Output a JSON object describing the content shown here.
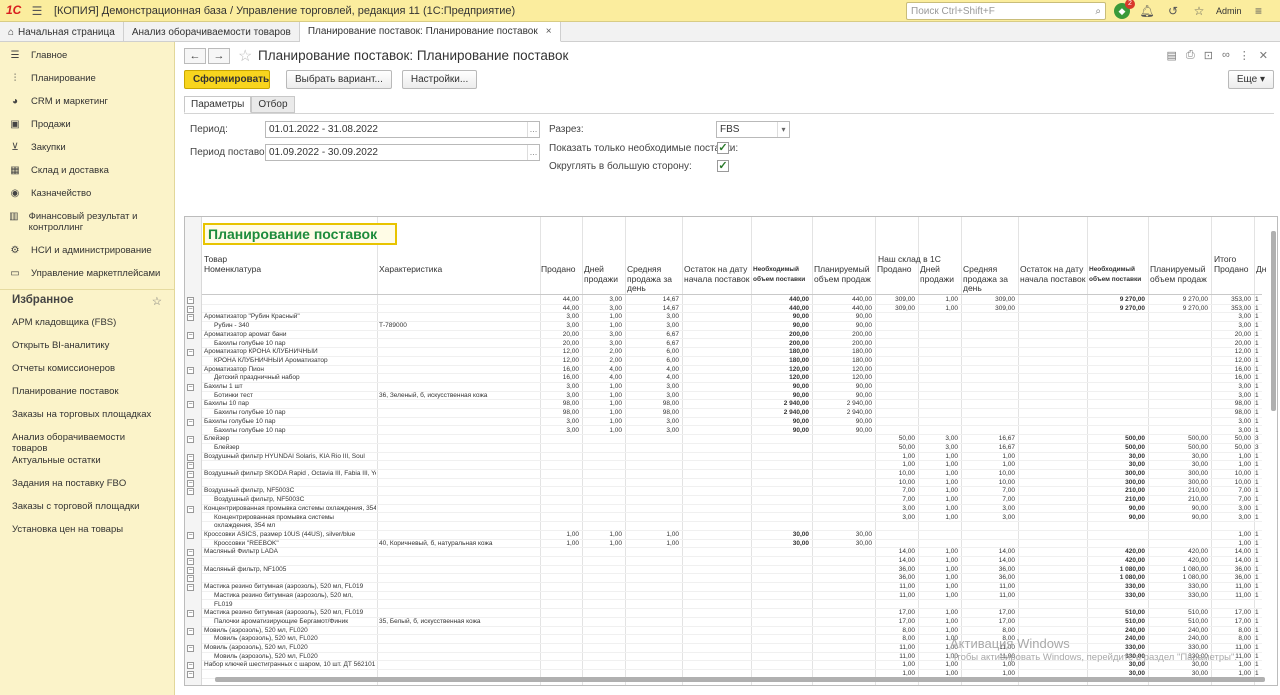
{
  "app": {
    "title": "[КОПИЯ] Демонстрационная база / Управление торговлей, редакция 11  (1С:Предприятие)",
    "search_placeholder": "Поиск Ctrl+Shift+F",
    "notification_count": "2",
    "user": "Admin"
  },
  "tabs": [
    {
      "label": "Начальная страница"
    },
    {
      "label": "Анализ оборачиваемости товаров"
    },
    {
      "label": "Планирование поставок: Планирование поставок"
    }
  ],
  "sidebar": {
    "items": [
      {
        "label": "Главное",
        "icon": "menu-icon"
      },
      {
        "label": "Планирование",
        "icon": "planning-icon"
      },
      {
        "label": "CRM и маркетинг",
        "icon": "pie-icon"
      },
      {
        "label": "Продажи",
        "icon": "bag-icon"
      },
      {
        "label": "Закупки",
        "icon": "cart-icon"
      },
      {
        "label": "Склад и доставка",
        "icon": "warehouse-icon"
      },
      {
        "label": "Казначейство",
        "icon": "money-icon"
      },
      {
        "label": "Финансовый результат и контроллинг",
        "icon": "chart-icon"
      },
      {
        "label": "НСИ и администрирование",
        "icon": "gear-icon"
      },
      {
        "label": "Управление маркетплейсами",
        "icon": "chat-icon"
      }
    ],
    "fav_title": "Избранное",
    "favorites": [
      "АРМ кладовщика (FBS)",
      "Открыть BI-аналитику",
      "Отчеты комиссионеров",
      "Планирование поставок",
      "Заказы на торговых площадках",
      "Анализ оборачиваемости товаров",
      "Актуальные остатки",
      "Задания на поставку FBO",
      "Заказы с торговой площадки",
      "Установка цен на товары"
    ]
  },
  "form": {
    "title": "Планирование поставок: Планирование поставок",
    "generate": "Сформировать",
    "choose_variant": "Выбрать вариант...",
    "settings": "Настройки...",
    "more": "Еще",
    "tab_params": "Параметры",
    "tab_filter": "Отбор",
    "period_label": "Период:",
    "period_value": "01.01.2022 - 31.08.2022",
    "delivery_label": "Период поставок:",
    "delivery_value": "01.09.2022 - 30.09.2022",
    "section_label": "Разрез:",
    "section_value": "FBS",
    "only_needed_label": "Показать только необходимые поставки:",
    "only_needed": true,
    "round_up_label": "Округлять в большую сторону:",
    "round_up": true
  },
  "report": {
    "title": "Планирование поставок",
    "group_product": "Товар",
    "col_nomenclature": "Номенклатура",
    "col_characteristic": "Характеристика",
    "group_warehouse": "Наш склад в 1С",
    "group_total": "Итого",
    "col_sold": "Продано",
    "col_days": "Дней продажи",
    "col_avg": "Средняя продажа за день",
    "col_stock": "Остаток на дату начала поставок",
    "col_need": "Необходимый объем поставки",
    "col_plan": "Планируемый объем продаж",
    "col_days2": "Дне",
    "rows": [
      [
        "",
        "",
        "44,00",
        "3,00",
        "14,67",
        "",
        "440,00",
        "440,00",
        "309,00",
        "1,00",
        "309,00",
        "",
        "9 270,00",
        "9 270,00",
        "353,00",
        "1"
      ],
      [
        "",
        "",
        "44,00",
        "3,00",
        "14,67",
        "",
        "440,00",
        "440,00",
        "309,00",
        "1,00",
        "309,00",
        "",
        "9 270,00",
        "9 270,00",
        "353,00",
        "1"
      ],
      [
        "Ароматизатор \"Рубин Красный\"",
        "",
        "3,00",
        "1,00",
        "3,00",
        "",
        "90,00",
        "90,00",
        "",
        "",
        "",
        "",
        "",
        "",
        "3,00",
        "1"
      ],
      [
        "Рубин - 340",
        "Т-789000",
        "3,00",
        "1,00",
        "3,00",
        "",
        "90,00",
        "90,00",
        "",
        "",
        "",
        "",
        "",
        "",
        "3,00",
        "1"
      ],
      [
        "Ароматизатор аромат бани",
        "",
        "20,00",
        "3,00",
        "6,67",
        "",
        "200,00",
        "200,00",
        "",
        "",
        "",
        "",
        "",
        "",
        "20,00",
        "1"
      ],
      [
        "Бахилы голубые 10 пар",
        "",
        "20,00",
        "3,00",
        "6,67",
        "",
        "200,00",
        "200,00",
        "",
        "",
        "",
        "",
        "",
        "",
        "20,00",
        "1"
      ],
      [
        "Ароматизатор КРОНА КЛУБНИЧНЫЙ",
        "",
        "12,00",
        "2,00",
        "6,00",
        "",
        "180,00",
        "180,00",
        "",
        "",
        "",
        "",
        "",
        "",
        "12,00",
        "1"
      ],
      [
        "КРОНА КЛУБНИЧНЫЙ Ароматизатор",
        "",
        "12,00",
        "2,00",
        "6,00",
        "",
        "180,00",
        "180,00",
        "",
        "",
        "",
        "",
        "",
        "",
        "12,00",
        "1"
      ],
      [
        "Ароматизатор Пион",
        "",
        "16,00",
        "4,00",
        "4,00",
        "",
        "120,00",
        "120,00",
        "",
        "",
        "",
        "",
        "",
        "",
        "16,00",
        "1"
      ],
      [
        "Детский праздничный набор",
        "",
        "16,00",
        "4,00",
        "4,00",
        "",
        "120,00",
        "120,00",
        "",
        "",
        "",
        "",
        "",
        "",
        "16,00",
        "1"
      ],
      [
        "Бахилы 1 шт",
        "",
        "3,00",
        "1,00",
        "3,00",
        "",
        "90,00",
        "90,00",
        "",
        "",
        "",
        "",
        "",
        "",
        "3,00",
        "1"
      ],
      [
        "Ботинки тест",
        "36, Зеленый, б, искусственная кожа",
        "3,00",
        "1,00",
        "3,00",
        "",
        "90,00",
        "90,00",
        "",
        "",
        "",
        "",
        "",
        "",
        "3,00",
        "1"
      ],
      [
        "Бахилы 10 пар",
        "",
        "98,00",
        "1,00",
        "98,00",
        "",
        "2 940,00",
        "2 940,00",
        "",
        "",
        "",
        "",
        "",
        "",
        "98,00",
        "1"
      ],
      [
        "Бахилы голубые 10 пар",
        "",
        "98,00",
        "1,00",
        "98,00",
        "",
        "2 940,00",
        "2 940,00",
        "",
        "",
        "",
        "",
        "",
        "",
        "98,00",
        "1"
      ],
      [
        "Бахилы голубые 10 пар",
        "",
        "3,00",
        "1,00",
        "3,00",
        "",
        "90,00",
        "90,00",
        "",
        "",
        "",
        "",
        "",
        "",
        "3,00",
        "1"
      ],
      [
        "Бахилы голубые 10 пар",
        "",
        "3,00",
        "1,00",
        "3,00",
        "",
        "90,00",
        "90,00",
        "",
        "",
        "",
        "",
        "",
        "",
        "3,00",
        "1"
      ],
      [
        "Блейзер",
        "",
        "",
        "",
        "",
        "",
        "",
        "",
        "50,00",
        "3,00",
        "16,67",
        "",
        "500,00",
        "500,00",
        "50,00",
        "3"
      ],
      [
        "Блейзер",
        "",
        "",
        "",
        "",
        "",
        "",
        "",
        "50,00",
        "3,00",
        "16,67",
        "",
        "500,00",
        "500,00",
        "50,00",
        "3"
      ],
      [
        "Воздушный фильтр HYUNDAI Solaris, KIA Rio III, Soul",
        "",
        "",
        "",
        "",
        "",
        "",
        "",
        "1,00",
        "1,00",
        "1,00",
        "",
        "30,00",
        "30,00",
        "1,00",
        "1"
      ],
      [
        "",
        "",
        "",
        "",
        "",
        "",
        "",
        "",
        "1,00",
        "1,00",
        "1,00",
        "",
        "30,00",
        "30,00",
        "1,00",
        "1"
      ],
      [
        "Воздушный фильтр SKODA Rapid , Octavia III, Fabia III, Yeti; VOLKSWAGEN Polo V",
        "",
        "",
        "",
        "",
        "",
        "",
        "",
        "10,00",
        "1,00",
        "10,00",
        "",
        "300,00",
        "300,00",
        "10,00",
        "1"
      ],
      [
        "",
        "",
        "",
        "",
        "",
        "",
        "",
        "",
        "10,00",
        "1,00",
        "10,00",
        "",
        "300,00",
        "300,00",
        "10,00",
        "1"
      ],
      [
        "Воздушный фильтр, NF5003C",
        "",
        "",
        "",
        "",
        "",
        "",
        "",
        "7,00",
        "1,00",
        "7,00",
        "",
        "210,00",
        "210,00",
        "7,00",
        "1"
      ],
      [
        "Воздушный фильтр, NF5003C",
        "",
        "",
        "",
        "",
        "",
        "",
        "",
        "7,00",
        "1,00",
        "7,00",
        "",
        "210,00",
        "210,00",
        "7,00",
        "1"
      ],
      [
        "Концентрированная промывка системы охлаждения, 354 мл",
        "",
        "",
        "",
        "",
        "",
        "",
        "",
        "3,00",
        "1,00",
        "3,00",
        "",
        "90,00",
        "90,00",
        "3,00",
        "1"
      ],
      [
        "Концентрированная промывка системы",
        "",
        "",
        "",
        "",
        "",
        "",
        "",
        "3,00",
        "1,00",
        "3,00",
        "",
        "90,00",
        "90,00",
        "3,00",
        "1"
      ],
      [
        "охлаждения, 354 мл",
        "",
        "",
        "",
        "",
        "",
        "",
        "",
        "",
        "",
        "",
        "",
        "",
        "",
        "",
        ""
      ],
      [
        "Кроссовки ASICS, размер 10US (44US), silver/blue",
        "",
        "1,00",
        "1,00",
        "1,00",
        "",
        "30,00",
        "30,00",
        "",
        "",
        "",
        "",
        "",
        "",
        "1,00",
        "1"
      ],
      [
        "Кроссовки \"REEBOK\"",
        "40, Коричневый, б, натуральная кожа",
        "1,00",
        "1,00",
        "1,00",
        "",
        "30,00",
        "30,00",
        "",
        "",
        "",
        "",
        "",
        "",
        "1,00",
        "1"
      ],
      [
        "Масляный Фильтр LADA",
        "",
        "",
        "",
        "",
        "",
        "",
        "",
        "14,00",
        "1,00",
        "14,00",
        "",
        "420,00",
        "420,00",
        "14,00",
        "1"
      ],
      [
        "",
        "",
        "",
        "",
        "",
        "",
        "",
        "",
        "14,00",
        "1,00",
        "14,00",
        "",
        "420,00",
        "420,00",
        "14,00",
        "1"
      ],
      [
        "Масляный фильтр, NF1005",
        "",
        "",
        "",
        "",
        "",
        "",
        "",
        "36,00",
        "1,00",
        "36,00",
        "",
        "1 080,00",
        "1 080,00",
        "36,00",
        "1"
      ],
      [
        "",
        "",
        "",
        "",
        "",
        "",
        "",
        "",
        "36,00",
        "1,00",
        "36,00",
        "",
        "1 080,00",
        "1 080,00",
        "36,00",
        "1"
      ],
      [
        "Мастика резино битумная (аэрозоль), 520 мл, FL019",
        "",
        "",
        "",
        "",
        "",
        "",
        "",
        "11,00",
        "1,00",
        "11,00",
        "",
        "330,00",
        "330,00",
        "11,00",
        "1"
      ],
      [
        "Мастика резино битумная (аэрозоль), 520 мл,",
        "",
        "",
        "",
        "",
        "",
        "",
        "",
        "11,00",
        "1,00",
        "11,00",
        "",
        "330,00",
        "330,00",
        "11,00",
        "1"
      ],
      [
        "FL019",
        "",
        "",
        "",
        "",
        "",
        "",
        "",
        "",
        "",
        "",
        "",
        "",
        "",
        "",
        ""
      ],
      [
        "Мастика резино битумная (аэрозоль), 520 мл, FL019",
        "",
        "",
        "",
        "",
        "",
        "",
        "",
        "17,00",
        "1,00",
        "17,00",
        "",
        "510,00",
        "510,00",
        "17,00",
        "1"
      ],
      [
        "Палочки ароматизирующие Бергамот/Финик",
        "35, Белый, б, искусственная кожа",
        "",
        "",
        "",
        "",
        "",
        "",
        "17,00",
        "1,00",
        "17,00",
        "",
        "510,00",
        "510,00",
        "17,00",
        "1"
      ],
      [
        "Мовиль (аэрозоль), 520 мл, FL020",
        "",
        "",
        "",
        "",
        "",
        "",
        "",
        "8,00",
        "1,00",
        "8,00",
        "",
        "240,00",
        "240,00",
        "8,00",
        "1"
      ],
      [
        "Мовиль (аэрозоль), 520 мл, FL020",
        "",
        "",
        "",
        "",
        "",
        "",
        "",
        "8,00",
        "1,00",
        "8,00",
        "",
        "240,00",
        "240,00",
        "8,00",
        "1"
      ],
      [
        "Мовиль (аэрозоль), 520 мл, FL020",
        "",
        "",
        "",
        "",
        "",
        "",
        "",
        "11,00",
        "1,00",
        "11,00",
        "",
        "330,00",
        "330,00",
        "11,00",
        "1"
      ],
      [
        "Мовиль (аэрозоль), 520 мл, FL020",
        "",
        "",
        "",
        "",
        "",
        "",
        "",
        "11,00",
        "1,00",
        "11,00",
        "",
        "330,00",
        "330,00",
        "11,00",
        "1"
      ],
      [
        "Набор ключей шестигранных с шаром, 10 шт. ДТ 562101",
        "",
        "",
        "",
        "",
        "",
        "",
        "",
        "1,00",
        "1,00",
        "1,00",
        "",
        "30,00",
        "30,00",
        "1,00",
        "1"
      ],
      [
        "",
        "",
        "",
        "",
        "",
        "",
        "",
        "",
        "1,00",
        "1,00",
        "1,00",
        "",
        "30,00",
        "30,00",
        "1,00",
        "1"
      ]
    ]
  },
  "watermark": {
    "line1": "Активация Windows",
    "line2": "Чтобы активировать Windows, перейдите в раздел \"Параметры\"."
  }
}
